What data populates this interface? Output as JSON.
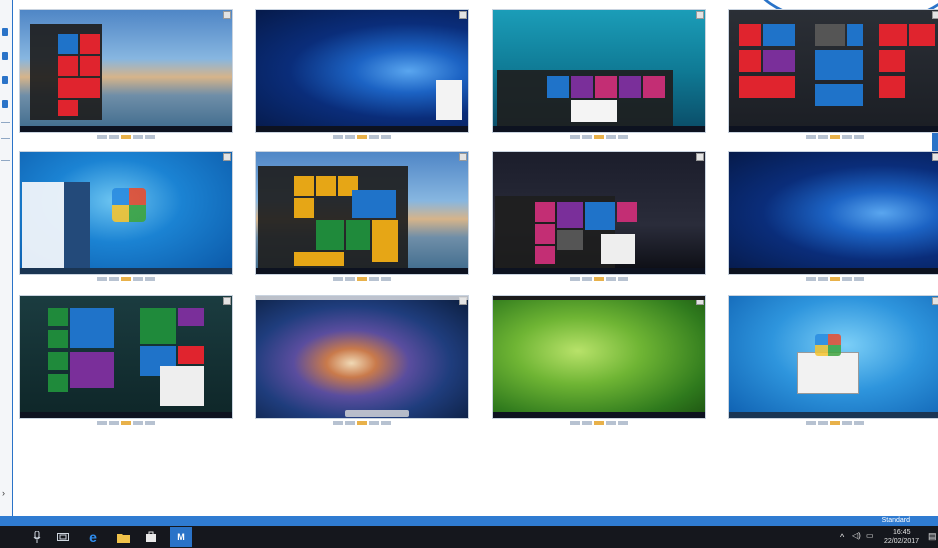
{
  "status_bar": {
    "label": "Standard"
  },
  "taskbar": {
    "icons": [
      {
        "name": "microphone-icon",
        "glyph": "🎙"
      },
      {
        "name": "task-view-icon",
        "glyph": "▭"
      },
      {
        "name": "edge-browser-icon",
        "glyph": "e"
      },
      {
        "name": "file-explorer-icon",
        "glyph": "▰"
      },
      {
        "name": "store-icon",
        "glyph": "■"
      },
      {
        "name": "app-m-icon",
        "glyph": "M"
      }
    ],
    "clock_time": "16:45",
    "clock_date": "22/02/2017"
  },
  "thumbnails": [
    {
      "wallpaper": "beach",
      "theme": "win10"
    },
    {
      "wallpaper": "win10",
      "theme": "win10"
    },
    {
      "wallpaper": "sea",
      "theme": "win10"
    },
    {
      "wallpaper": "dark",
      "theme": "win10"
    },
    {
      "wallpaper": "win7",
      "theme": "win7"
    },
    {
      "wallpaper": "beach",
      "theme": "win10"
    },
    {
      "wallpaper": "night",
      "theme": "win10"
    },
    {
      "wallpaper": "win10",
      "theme": "win10"
    },
    {
      "wallpaper": "teal",
      "theme": "win10"
    },
    {
      "wallpaper": "galaxy",
      "theme": "mac"
    },
    {
      "wallpaper": "green",
      "theme": "linux"
    },
    {
      "wallpaper": "win7b",
      "theme": "win7"
    }
  ],
  "colors": {
    "accent": "#2a73c8",
    "taskbar": "#15171d",
    "tile_blue": "#1f73c9",
    "tile_red": "#e0242e",
    "tile_green": "#1f8a3b",
    "tile_purple": "#7a2f9a",
    "tile_magenta": "#c32e74",
    "tile_orange": "#e6a616"
  }
}
